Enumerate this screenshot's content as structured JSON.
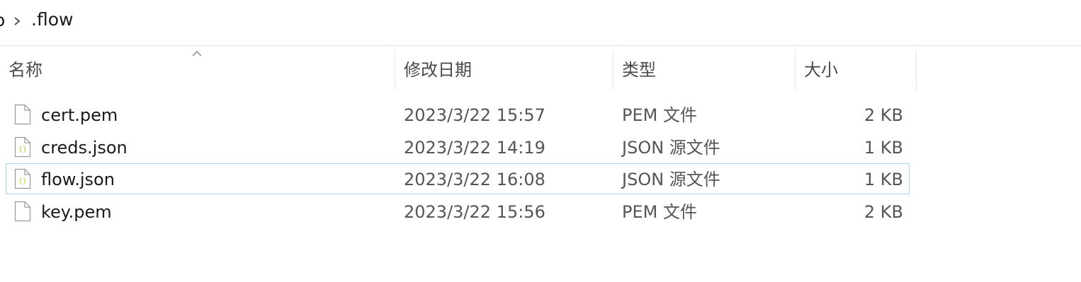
{
  "breadcrumb": {
    "partial_prev": "o",
    "current": ".flow"
  },
  "columns": {
    "name": "名称",
    "date": "修改日期",
    "type": "类型",
    "size": "大小"
  },
  "files": [
    {
      "name": "cert.pem",
      "modified": "2023/3/22 15:57",
      "type": "PEM 文件",
      "size": "2 KB",
      "icon": "document-icon"
    },
    {
      "name": "creds.json",
      "modified": "2023/3/22 14:19",
      "type": "JSON 源文件",
      "size": "1 KB",
      "icon": "json-file-icon"
    },
    {
      "name": "flow.json",
      "modified": "2023/3/22 16:08",
      "type": "JSON 源文件",
      "size": "1 KB",
      "icon": "json-file-icon",
      "focused": true
    },
    {
      "name": "key.pem",
      "modified": "2023/3/22 15:56",
      "type": "PEM 文件",
      "size": "2 KB",
      "icon": "document-icon"
    }
  ],
  "colors": {
    "focus_border": "#a8d4f0",
    "json_icon_accent": "#b5c832"
  }
}
